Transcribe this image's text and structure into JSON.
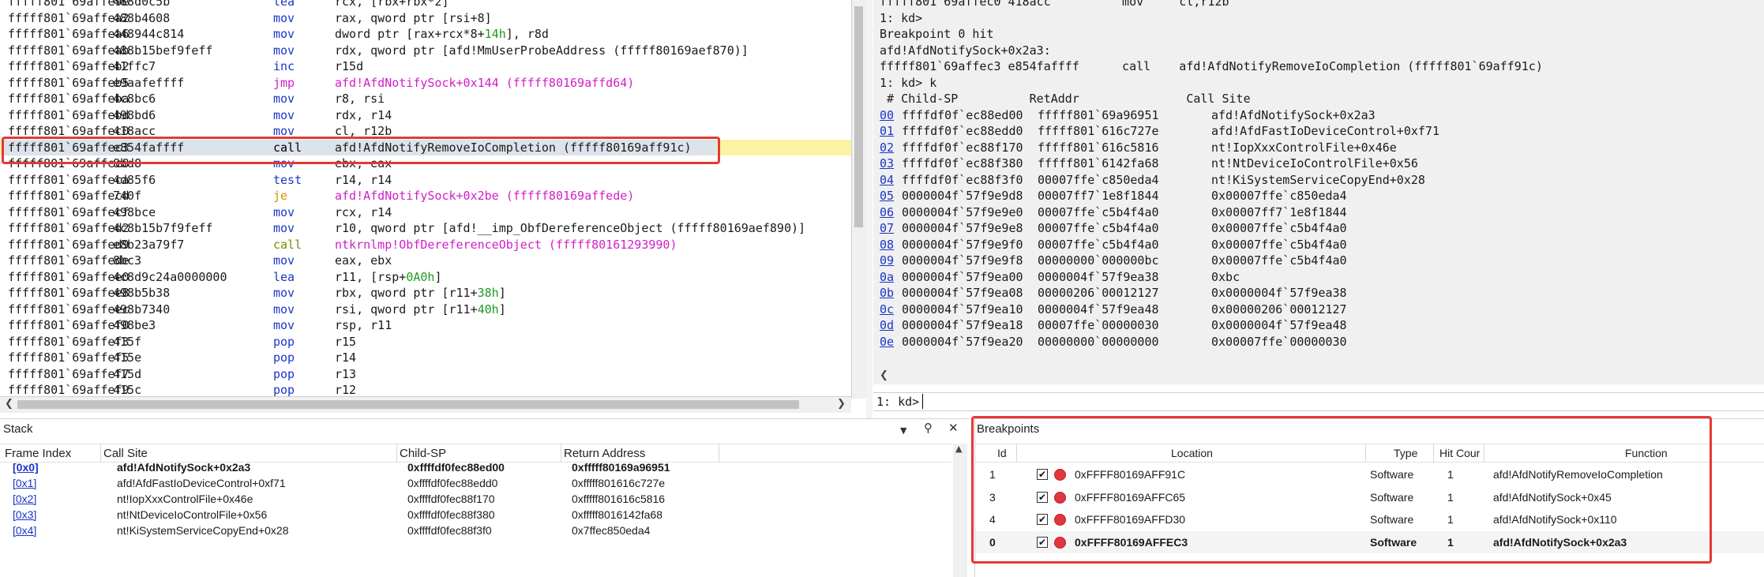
{
  "disassembly": [
    {
      "addr": "fffff801`69affe9e",
      "bytes": "488d0c5b",
      "op": "lea",
      "op_color": "blue",
      "args": "rcx, [rbx+rbx*2]"
    },
    {
      "addr": "fffff801`69affea2",
      "bytes": "488b4608",
      "op": "mov",
      "op_color": "blue",
      "args": "rax, qword ptr [rsi+8]"
    },
    {
      "addr": "fffff801`69affea6",
      "bytes": "448944c814",
      "op": "mov",
      "op_color": "blue",
      "args": "dword ptr [rax+rcx*8+",
      "num": "14h",
      "args_tail": "], r8d"
    },
    {
      "addr": "fffff801`69affeab",
      "bytes": "488b15bef9feff",
      "op": "mov",
      "op_color": "blue",
      "args": "rdx, qword ptr [afd!MmUserProbeAddress (fffff80169aef870)]"
    },
    {
      "addr": "fffff801`69affeb2",
      "bytes": "41ffc7",
      "op": "inc",
      "op_color": "blue",
      "args": "r15d"
    },
    {
      "addr": "fffff801`69affeb5",
      "bytes": "e9aafeffff",
      "op": "jmp",
      "op_color": "magenta",
      "args": "afd!AfdNotifySock+0x144 (fffff80169affd64)",
      "args_color": "magenta"
    },
    {
      "addr": "fffff801`69affeba",
      "bytes": "4c8bc6",
      "op": "mov",
      "op_color": "blue",
      "args": "r8, rsi"
    },
    {
      "addr": "fffff801`69affebd",
      "bytes": "498bd6",
      "op": "mov",
      "op_color": "blue",
      "args": "rdx, r14"
    },
    {
      "addr": "fffff801`69affec0",
      "bytes": "418acc",
      "op": "mov",
      "op_color": "blue",
      "args": "cl, r12b"
    },
    {
      "addr": "fffff801`69affec3",
      "bytes": "e854faffff",
      "op": "call",
      "op_color": "dark",
      "args": "afd!AfdNotifyRemoveIoCompletion (fffff80169aff91c)",
      "current": true
    },
    {
      "addr": "fffff801`69affec8",
      "bytes": "8bd8",
      "op": "mov",
      "op_color": "blue",
      "args": "ebx, eax"
    },
    {
      "addr": "fffff801`69affeca",
      "bytes": "4d85f6",
      "op": "test",
      "op_color": "blue",
      "args": "r14, r14"
    },
    {
      "addr": "fffff801`69affecd",
      "bytes": "740f",
      "op": "je",
      "op_color": "orange",
      "args": "afd!AfdNotifySock+0x2be (fffff80169affede)",
      "args_color": "magenta"
    },
    {
      "addr": "fffff801`69affecf",
      "bytes": "498bce",
      "op": "mov",
      "op_color": "blue",
      "args": "rcx, r14"
    },
    {
      "addr": "fffff801`69affed2",
      "bytes": "4c8b15b7f9feff",
      "op": "mov",
      "op_color": "blue",
      "args": "r10, qword ptr [afd!__imp_ObfDereferenceObject (fffff80169aef890)]"
    },
    {
      "addr": "fffff801`69affed9",
      "bytes": "e8b23a79f7",
      "op": "call",
      "op_color": "olive",
      "args": "ntkrnlmp!ObfDereferenceObject (fffff80161293990)",
      "args_color": "magenta"
    },
    {
      "addr": "fffff801`69affede",
      "bytes": "8bc3",
      "op": "mov",
      "op_color": "blue",
      "args": "eax, ebx"
    },
    {
      "addr": "fffff801`69affee0",
      "bytes": "4c8d9c24a0000000",
      "op": "lea",
      "op_color": "blue",
      "args": "r11, [rsp+",
      "num": "0A0h",
      "args_tail": "]"
    },
    {
      "addr": "fffff801`69affee8",
      "bytes": "498b5b38",
      "op": "mov",
      "op_color": "blue",
      "args": "rbx, qword ptr [r11+",
      "num": "38h",
      "args_tail": "]"
    },
    {
      "addr": "fffff801`69affeec",
      "bytes": "498b7340",
      "op": "mov",
      "op_color": "blue",
      "args": "rsi, qword ptr [r11+",
      "num": "40h",
      "args_tail": "]"
    },
    {
      "addr": "fffff801`69affef0",
      "bytes": "498be3",
      "op": "mov",
      "op_color": "blue",
      "args": "rsp, r11"
    },
    {
      "addr": "fffff801`69affef3",
      "bytes": "415f",
      "op": "pop",
      "op_color": "blue",
      "args": "r15"
    },
    {
      "addr": "fffff801`69affef5",
      "bytes": "415e",
      "op": "pop",
      "op_color": "blue",
      "args": "r14"
    },
    {
      "addr": "fffff801`69affef7",
      "bytes": "415d",
      "op": "pop",
      "op_color": "blue",
      "args": "r13"
    },
    {
      "addr": "fffff801`69affef9",
      "bytes": "415c",
      "op": "pop",
      "op_color": "blue",
      "args": "r12"
    }
  ],
  "command": {
    "lines": [
      "fffff801`69affec0 418acc          mov     cl,r12b",
      "1: kd>",
      "Breakpoint 0 hit",
      "afd!AfdNotifySock+0x2a3:",
      "fffff801`69affec3 e854faffff      call    afd!AfdNotifyRemoveIoCompletion (fffff801`69aff91c)",
      "1: kd> k",
      " # Child-SP          RetAddr               Call Site"
    ],
    "stack_rows": [
      {
        "n": "00",
        "sp": "ffffdf0f`ec88ed00",
        "ret": "fffff801`69a96951",
        "site": "afd!AfdNotifySock+0x2a3"
      },
      {
        "n": "01",
        "sp": "ffffdf0f`ec88edd0",
        "ret": "fffff801`616c727e",
        "site": "afd!AfdFastIoDeviceControl+0xf71"
      },
      {
        "n": "02",
        "sp": "ffffdf0f`ec88f170",
        "ret": "fffff801`616c5816",
        "site": "nt!IopXxxControlFile+0x46e"
      },
      {
        "n": "03",
        "sp": "ffffdf0f`ec88f380",
        "ret": "fffff801`6142fa68",
        "site": "nt!NtDeviceIoControlFile+0x56"
      },
      {
        "n": "04",
        "sp": "ffffdf0f`ec88f3f0",
        "ret": "00007ffe`c850eda4",
        "site": "nt!KiSystemServiceCopyEnd+0x28"
      },
      {
        "n": "05",
        "sp": "0000004f`57f9e9d8",
        "ret": "00007ff7`1e8f1844",
        "site": "0x00007ffe`c850eda4"
      },
      {
        "n": "06",
        "sp": "0000004f`57f9e9e0",
        "ret": "00007ffe`c5b4f4a0",
        "site": "0x00007ff7`1e8f1844"
      },
      {
        "n": "07",
        "sp": "0000004f`57f9e9e8",
        "ret": "00007ffe`c5b4f4a0",
        "site": "0x00007ffe`c5b4f4a0"
      },
      {
        "n": "08",
        "sp": "0000004f`57f9e9f0",
        "ret": "00007ffe`c5b4f4a0",
        "site": "0x00007ffe`c5b4f4a0"
      },
      {
        "n": "09",
        "sp": "0000004f`57f9e9f8",
        "ret": "00000000`000000bc",
        "site": "0x00007ffe`c5b4f4a0"
      },
      {
        "n": "0a",
        "sp": "0000004f`57f9ea00",
        "ret": "0000004f`57f9ea38",
        "site": "0xbc"
      },
      {
        "n": "0b",
        "sp": "0000004f`57f9ea08",
        "ret": "00000206`00012127",
        "site": "0x0000004f`57f9ea38"
      },
      {
        "n": "0c",
        "sp": "0000004f`57f9ea10",
        "ret": "0000004f`57f9ea48",
        "site": "0x00000206`00012127"
      },
      {
        "n": "0d",
        "sp": "0000004f`57f9ea18",
        "ret": "00007ffe`00000030",
        "site": "0x0000004f`57f9ea48"
      },
      {
        "n": "0e",
        "sp": "0000004f`57f9ea20",
        "ret": "00000000`00000000",
        "site": "0x00007ffe`00000030"
      }
    ],
    "prompt": "1: kd>",
    "input_value": ""
  },
  "stack": {
    "title": "Stack",
    "headers": [
      "Frame Index",
      "Call Site",
      "Child-SP",
      "Return Address"
    ],
    "rows": [
      {
        "frame": "[0x0]",
        "site": "afd!AfdNotifySock+0x2a3",
        "sp": "0xffffdf0fec88ed00",
        "ret": "0xfffff80169a96951",
        "bold": true
      },
      {
        "frame": "[0x1]",
        "site": "afd!AfdFastIoDeviceControl+0xf71",
        "sp": "0xffffdf0fec88edd0",
        "ret": "0xfffff801616c727e"
      },
      {
        "frame": "[0x2]",
        "site": "nt!IopXxxControlFile+0x46e",
        "sp": "0xffffdf0fec88f170",
        "ret": "0xfffff801616c5816"
      },
      {
        "frame": "[0x3]",
        "site": "nt!NtDeviceIoControlFile+0x56",
        "sp": "0xffffdf0fec88f380",
        "ret": "0xfffff8016142fa68"
      },
      {
        "frame": "[0x4]",
        "site": "nt!KiSystemServiceCopyEnd+0x28",
        "sp": "0xffffdf0fec88f3f0",
        "ret": "0x7ffec850eda4"
      }
    ]
  },
  "breakpoints": {
    "title": "Breakpoints",
    "headers": [
      "Id",
      "Location",
      "Type",
      "Hit Cour",
      "Function"
    ],
    "rows": [
      {
        "id": "1",
        "location": "0xFFFF80169AFF91C",
        "type": "Software",
        "hits": "1",
        "function": "afd!AfdNotifyRemoveIoCompletion"
      },
      {
        "id": "3",
        "location": "0xFFFF80169AFFC65",
        "type": "Software",
        "hits": "1",
        "function": "afd!AfdNotifySock+0x45"
      },
      {
        "id": "4",
        "location": "0xFFFF80169AFFD30",
        "type": "Software",
        "hits": "1",
        "function": "afd!AfdNotifySock+0x110"
      },
      {
        "id": "0",
        "location": "0xFFFF80169AFFEC3",
        "type": "Software",
        "hits": "1",
        "function": "afd!AfdNotifySock+0x2a3",
        "bold": true
      }
    ]
  },
  "colors": {
    "highlight_box": "#e53935",
    "current_line": "#fbf3a3",
    "link": "#1a35c8",
    "breakpoint_dot": "#e0363d"
  }
}
